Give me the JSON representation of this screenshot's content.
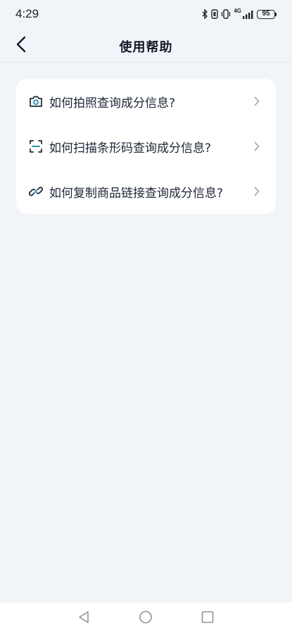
{
  "status_bar": {
    "time": "4:29",
    "network": "4G",
    "battery": "95"
  },
  "header": {
    "title": "使用帮助",
    "back_icon": "chevron-left-icon"
  },
  "help_items": [
    {
      "label": "如何拍照查询成分信息?",
      "icon": "camera-icon"
    },
    {
      "label": "如何扫描条形码查询成分信息?",
      "icon": "scan-icon"
    },
    {
      "label": "如何复制商品链接查询成分信息?",
      "icon": "link-icon"
    }
  ],
  "system_nav": {
    "back": "triangle-back-icon",
    "home": "circle-home-icon",
    "recents": "square-recents-icon"
  },
  "colors": {
    "background": "#f1f5fa",
    "card": "#ffffff",
    "accent": "#2a8fa6",
    "text": "#1e2636"
  }
}
